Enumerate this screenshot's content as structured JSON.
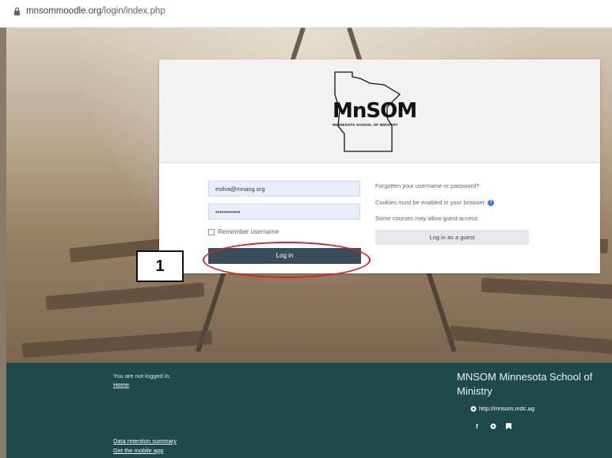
{
  "browser": {
    "url_host": "mnsommoodle.org",
    "url_path": "/login/index.php"
  },
  "logo": {
    "text": "MnSOM",
    "subtitle": "MINNESOTA SCHOOL OF MINISTRY"
  },
  "login": {
    "username_value": "esilva@mnaog.org",
    "password_value": "••••••••••••",
    "remember_label": "Remember username",
    "login_button": "Log in",
    "forgot_link": "Forgotten your username or password?",
    "cookies_text": "Cookies must be enabled in your browser",
    "guest_text": "Some courses may allow guest access",
    "guest_button": "Log in as a guest"
  },
  "annotation": {
    "step_number": "1",
    "highlight_color": "#e02020"
  },
  "footer": {
    "not_logged_in": "You are not logged in.",
    "home_link": "Home",
    "data_retention": "Data retention summary",
    "mobile_app": "Get the mobile app",
    "site_name": "MNSOM Minnesota School of Ministry",
    "site_url": "http://mnsom.mdc.ag",
    "background_color": "#1e4a4c"
  },
  "colors": {
    "login_button_bg": "#3a4d5a",
    "input_bg": "#e8eefb"
  }
}
